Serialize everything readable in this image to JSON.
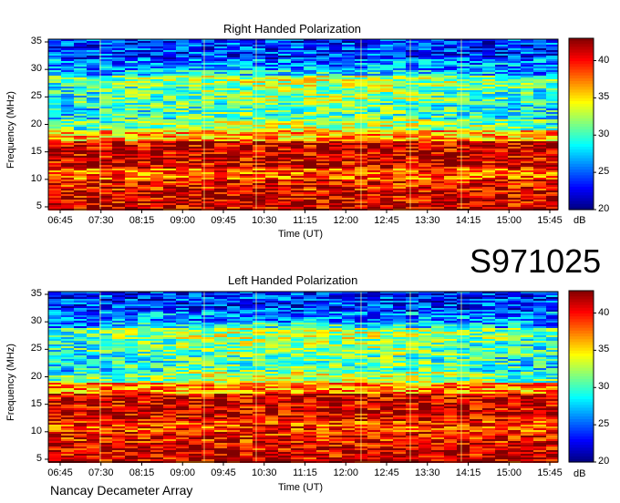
{
  "chart_data": [
    {
      "type": "heatmap",
      "title": "Right Handed Polarization",
      "xlabel": "Time (UT)",
      "ylabel": "Frequency (MHz)",
      "x_ticks": [
        "06:45",
        "07:30",
        "08:15",
        "09:00",
        "09:45",
        "10:30",
        "11:15",
        "12:00",
        "12:45",
        "13:30",
        "14:15",
        "15:00",
        "15:45"
      ],
      "y_ticks": [
        5,
        10,
        15,
        20,
        25,
        30,
        35
      ],
      "ylim": [
        4.5,
        35.5
      ],
      "colorbar": {
        "label": "dB",
        "ticks": [
          20,
          25,
          30,
          35,
          40
        ],
        "range": [
          20,
          43
        ]
      },
      "bands": [
        {
          "f": [
            4.5,
            8
          ],
          "db": 41
        },
        {
          "f": [
            8,
            10
          ],
          "db": 40
        },
        {
          "f": [
            10,
            12
          ],
          "db": 38
        },
        {
          "f": [
            12,
            17
          ],
          "db": 41
        },
        {
          "f": [
            17,
            19
          ],
          "db": 36
        },
        {
          "f": [
            19,
            21
          ],
          "db": 30
        },
        {
          "f": [
            21,
            24
          ],
          "db": 28
        },
        {
          "f": [
            24,
            27
          ],
          "db": 29
        },
        {
          "f": [
            27,
            29
          ],
          "db": 30
        },
        {
          "f": [
            29,
            32
          ],
          "db": 26
        },
        {
          "f": [
            32,
            35.5
          ],
          "db": 24
        }
      ]
    },
    {
      "type": "heatmap",
      "title": "Left Handed Polarization",
      "xlabel": "Time (UT)",
      "ylabel": "Frequency (MHz)",
      "x_ticks": [
        "06:45",
        "07:30",
        "08:15",
        "09:00",
        "09:45",
        "10:30",
        "11:15",
        "12:00",
        "12:45",
        "13:30",
        "14:15",
        "15:00",
        "15:45"
      ],
      "y_ticks": [
        5,
        10,
        15,
        20,
        25,
        30,
        35
      ],
      "ylim": [
        4.5,
        35.5
      ],
      "colorbar": {
        "label": "dB",
        "ticks": [
          20,
          25,
          30,
          35,
          40
        ],
        "range": [
          20,
          43
        ]
      },
      "bands": [
        {
          "f": [
            4.5,
            8
          ],
          "db": 41
        },
        {
          "f": [
            8,
            10
          ],
          "db": 40
        },
        {
          "f": [
            10,
            12
          ],
          "db": 39
        },
        {
          "f": [
            12,
            17
          ],
          "db": 41
        },
        {
          "f": [
            17,
            19
          ],
          "db": 37
        },
        {
          "f": [
            19,
            21
          ],
          "db": 30
        },
        {
          "f": [
            21,
            24
          ],
          "db": 28
        },
        {
          "f": [
            24,
            27
          ],
          "db": 29
        },
        {
          "f": [
            27,
            29
          ],
          "db": 30
        },
        {
          "f": [
            29,
            32
          ],
          "db": 26
        },
        {
          "f": [
            32,
            35.5
          ],
          "db": 24
        }
      ]
    }
  ],
  "event_id": "S971025",
  "instrument": "Nancay Decameter Array"
}
